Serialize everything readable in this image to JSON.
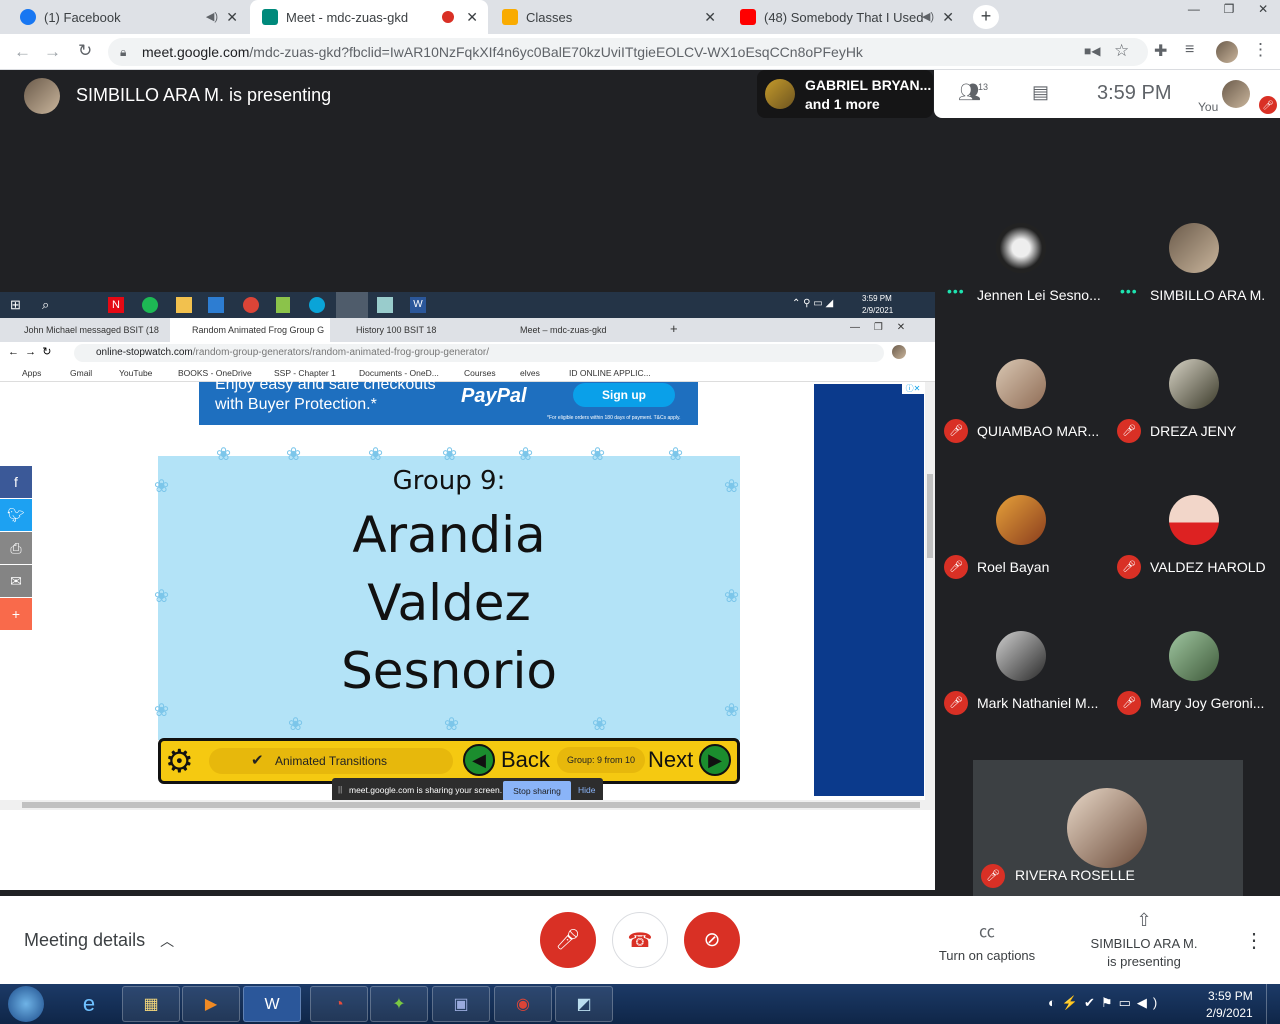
{
  "browser": {
    "tabs": [
      {
        "title": "(1) Facebook",
        "favicon_color": "#1877f2"
      },
      {
        "title": "Meet - mdc-zuas-gkd",
        "favicon_color": "#00897b"
      },
      {
        "title": "Classes",
        "favicon_color": "#f9ab00"
      },
      {
        "title": "(48) Somebody That I Used T",
        "favicon_color": "#ff0000"
      }
    ],
    "url_host": "meet.google.com",
    "url_path": "/mdc-zuas-gkd?fbclid=IwAR10NzFqkXIf4n6yc0BalE70kzUviITtgieEOLCV-WX1oEsqCCn8oPFeyHk"
  },
  "meet": {
    "presenting_text": "SIMBILLO ARA M. is presenting",
    "speaker_name": "GABRIEL BRYAN...",
    "speaker_more": "and 1 more",
    "participant_count": "13",
    "time": "3:59  PM",
    "you_label": "You",
    "participants": [
      {
        "name": "Jennen Lei Sesno...",
        "muted": false
      },
      {
        "name": "SIMBILLO ARA M.",
        "muted": false
      },
      {
        "name": "QUIAMBAO MAR...",
        "muted": true
      },
      {
        "name": "DREZA JENY",
        "muted": true
      },
      {
        "name": "Roel Bayan",
        "muted": true
      },
      {
        "name": "VALDEZ HAROLD",
        "muted": true
      },
      {
        "name": "Mark Nathaniel M...",
        "muted": true
      },
      {
        "name": "Mary Joy Geroni...",
        "muted": true
      }
    ],
    "featured_participant": "RIVERA ROSELLE",
    "meeting_details": "Meeting details",
    "captions_label": "Turn on captions",
    "presenting_label": "SIMBILLO ARA M. is presenting",
    "accent_red": "#d93025"
  },
  "shared": {
    "taskbar_time": "3:59 PM",
    "taskbar_date": "2/9/2021",
    "inner_tabs": [
      "John Michael messaged BSIT (18",
      "Random Animated Frog Group G",
      "History 100 BSIT 18",
      "Meet – mdc-zuas-gkd"
    ],
    "inner_url_host": "online-stopwatch.com",
    "inner_url_path": "/random-group-generators/random-animated-frog-group-generator/",
    "bookmarks": [
      "Apps",
      "Gmail",
      "YouTube",
      "BOOKS - OneDrive",
      "SSP - Chapter 1",
      "Documents - OneD...",
      "Courses",
      "elves",
      "ID ONLINE APPLIC..."
    ],
    "ad_line1": "Enjoy easy and safe checkouts",
    "ad_line2": "with Buyer Protection.*",
    "ad_brand": "PayPal",
    "ad_button": "Sign up",
    "ad_fine": "*For eligible orders within 180 days of payment. T&Cs apply.",
    "group_title": "Group 9:",
    "members": [
      "Arandia",
      "Valdez",
      "Sesnorio"
    ],
    "animated_transitions": "Animated Transitions",
    "back": "Back",
    "group_counter": "Group: 9 from 10",
    "next": "Next",
    "sharing_msg": "meet.google.com is sharing your screen.",
    "stop_sharing": "Stop sharing",
    "hide": "Hide"
  },
  "windows": {
    "time": "3:59 PM",
    "date": "2/9/2021"
  }
}
